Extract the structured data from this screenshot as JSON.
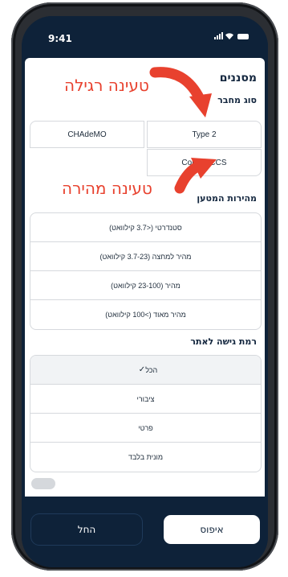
{
  "status": {
    "time": "9:41"
  },
  "filters": {
    "title": "מסננים",
    "connector_section": "סוג מחבר",
    "connectors": [
      "Type 2",
      "CHAdeMO",
      "Combo CCS"
    ],
    "speed_section": "מהירות המטען",
    "speeds": [
      "סטנדרטי (<3.7 קילוואט)",
      "מהיר למחצה (3.7-23 קילוואט)",
      "מהיר (23-100 קילוואט)",
      "מהיר מאוד (>100 קילוואט)"
    ],
    "access_section": "רמת גישה לאתר",
    "access_selected": "הכל",
    "access_options": [
      "ציבורי",
      "פרטי",
      "מונית בלבד"
    ]
  },
  "buttons": {
    "reset": "איפוס",
    "apply": "החל"
  },
  "annotations": {
    "regular": "טעינה רגילה",
    "fast": "טעינה מהירה"
  },
  "colors": {
    "primary": "#0e2239",
    "annotation": "#e8412e",
    "border": "#d6d9dd"
  }
}
